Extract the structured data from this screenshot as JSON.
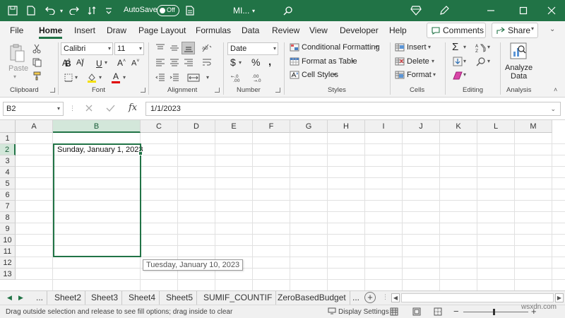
{
  "titlebar": {
    "autosave_label": "AutoSave",
    "autosave_state": "Off",
    "doc_name": "MI...",
    "accent": "#217346"
  },
  "menu": {
    "items": [
      "File",
      "Home",
      "Insert",
      "Draw",
      "Page Layout",
      "Formulas",
      "Data",
      "Review",
      "View",
      "Developer",
      "Help"
    ],
    "active": "Home",
    "comments_label": "Comments",
    "share_label": "Share"
  },
  "ribbon": {
    "clipboard": {
      "paste_label": "Paste",
      "group_label": "Clipboard"
    },
    "font": {
      "name": "Calibri",
      "size": "11",
      "group_label": "Font"
    },
    "alignment": {
      "group_label": "Alignment"
    },
    "number": {
      "format": "Date",
      "group_label": "Number"
    },
    "styles": {
      "conditional_formatting": "Conditional Formatting",
      "format_as_table": "Format as Table",
      "cell_styles": "Cell Styles",
      "group_label": "Styles"
    },
    "cells": {
      "insert": "Insert",
      "delete": "Delete",
      "format": "Format",
      "group_label": "Cells"
    },
    "editing": {
      "group_label": "Editing"
    },
    "analysis": {
      "analyze_line1": "Analyze",
      "analyze_line2": "Data",
      "group_label": "Analysis"
    }
  },
  "formula_bar": {
    "name_box": "B2",
    "fx": "fx",
    "value": "1/1/2023"
  },
  "grid": {
    "columns": [
      "A",
      "B",
      "C",
      "D",
      "E",
      "F",
      "G",
      "H",
      "I",
      "J",
      "K",
      "L",
      "M"
    ],
    "selected_column": "B",
    "rows": [
      "1",
      "2",
      "3",
      "4",
      "5",
      "6",
      "7",
      "8",
      "9",
      "10",
      "11",
      "12",
      "13"
    ],
    "selected_row": "2",
    "b2_value": "Sunday, January 1, 2023",
    "fill_tooltip": "Tuesday, January 10, 2023"
  },
  "sheets": {
    "tabs": [
      "...",
      "Sheet2",
      "Sheet3",
      "Sheet4",
      "Sheet5",
      "SUMIF_COUNTIF",
      "ZeroBasedBudget",
      "..."
    ]
  },
  "status": {
    "message": "Drag outside selection and release to see fill options; drag inside to clear",
    "display_settings": "Display Settings",
    "zoom_minus": "−",
    "zoom_plus": "+",
    "watermark": "wsxdn.com"
  }
}
